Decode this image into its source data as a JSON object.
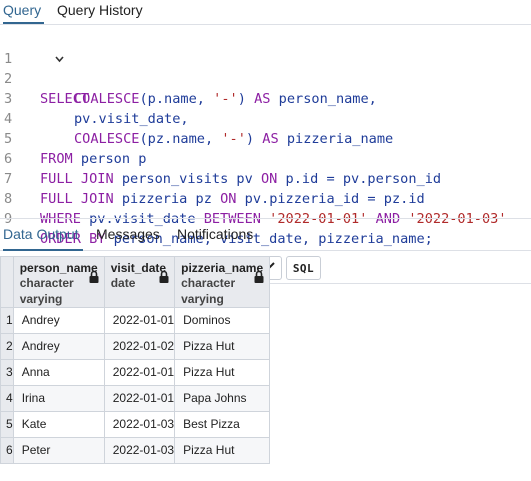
{
  "tabs": {
    "query": "Query",
    "history": "Query History"
  },
  "editor": {
    "lines": [
      "1",
      "2",
      "3",
      "4",
      "5",
      "6",
      "7",
      "8",
      "9"
    ],
    "sql": {
      "l1_select": "SELECT",
      "l2_coalesce": "COALESCE",
      "l2_args_a": "(p.name, ",
      "l2_str": "'-'",
      "l2_close": ") ",
      "l2_as": "AS",
      "l2_alias": " person_name,",
      "l3": "pv.visit_date,",
      "l4_coalesce": "COALESCE",
      "l4_args_a": "(pz.name, ",
      "l4_str": "'-'",
      "l4_close": ") ",
      "l4_as": "AS",
      "l4_alias": " pizzeria_name",
      "l5_from": "FROM",
      "l5_rest": " person p",
      "l6_join": "FULL JOIN",
      "l6_mid": " person_visits pv ",
      "l6_on": "ON",
      "l6_rest": " p.id = pv.person_id",
      "l7_join": "FULL JOIN",
      "l7_mid": " pizzeria pz ",
      "l7_on": "ON",
      "l7_rest": " pv.pizzeria_id = pz.id",
      "l8_where": "WHERE",
      "l8_mid": " pv.visit_date ",
      "l8_between": "BETWEEN",
      "l8_sp": " ",
      "l8_d1": "'2022-01-01'",
      "l8_and_sp": " ",
      "l8_and": "AND",
      "l8_sp2": " ",
      "l8_d2": "'2022-01-03'",
      "l9_order": "ORDER BY",
      "l9_rest": " person_name, visit_date, pizzeria_name;"
    }
  },
  "output_tabs": {
    "data": "Data Output",
    "messages": "Messages",
    "notifications": "Notifications"
  },
  "toolbar": {
    "sql_label": "SQL",
    "icons": [
      "add-row-icon",
      "copy-icon",
      "dropdown-icon",
      "paste-icon",
      "dropdown-icon",
      "delete-icon",
      "save-data-icon",
      "download-icon",
      "graph-icon",
      "sql-icon"
    ]
  },
  "grid": {
    "columns": [
      {
        "name": "person_name",
        "type": "character varying"
      },
      {
        "name": "visit_date",
        "type": "date"
      },
      {
        "name": "pizzeria_name",
        "type": "character varying"
      }
    ],
    "rows": [
      {
        "n": "1",
        "person_name": "Andrey",
        "visit_date": "2022-01-01",
        "pizzeria_name": "Dominos"
      },
      {
        "n": "2",
        "person_name": "Andrey",
        "visit_date": "2022-01-02",
        "pizzeria_name": "Pizza Hut"
      },
      {
        "n": "3",
        "person_name": "Anna",
        "visit_date": "2022-01-01",
        "pizzeria_name": "Pizza Hut"
      },
      {
        "n": "4",
        "person_name": "Irina",
        "visit_date": "2022-01-01",
        "pizzeria_name": "Papa Johns"
      },
      {
        "n": "5",
        "person_name": "Kate",
        "visit_date": "2022-01-03",
        "pizzeria_name": "Best Pizza"
      },
      {
        "n": "6",
        "person_name": "Peter",
        "visit_date": "2022-01-03",
        "pizzeria_name": "Pizza Hut"
      }
    ]
  },
  "colors": {
    "accent": "#326690",
    "keyword": "#8c1fa3",
    "string": "#b02a2a",
    "header_bg": "#e8eaee"
  }
}
